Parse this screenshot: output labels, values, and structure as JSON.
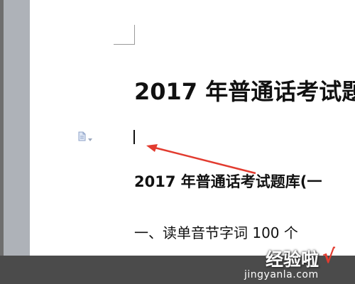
{
  "document": {
    "title": "2017 年普通话考试题",
    "heading": "2017 年普通话考试题库(一",
    "section": "一、读单音节字词 100 个"
  },
  "watermark": {
    "brand": "经验啦",
    "check": "√",
    "url": "jingyanla.com"
  },
  "colors": {
    "arrow": "#e23b2f",
    "page": "#ffffff",
    "margin": "#aeb2b8",
    "status_bar": "#4b4b4b"
  },
  "icons": {
    "paragraph_marker": "document-icon"
  }
}
